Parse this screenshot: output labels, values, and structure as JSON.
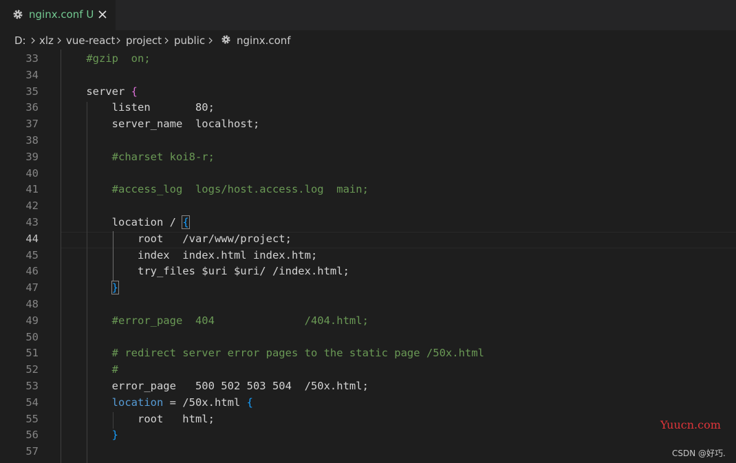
{
  "tab": {
    "title": "nginx.conf",
    "status": "U",
    "icon": "gear-icon",
    "close_icon": "close-icon",
    "color": "#73c991"
  },
  "breadcrumb": {
    "segments": [
      "D:",
      "xlz",
      "vue-react",
      "project",
      "public"
    ],
    "file": "nginx.conf",
    "file_icon": "gear-icon"
  },
  "editor": {
    "active_line": 44,
    "lines": [
      {
        "num": "33",
        "tokens": [
          [
            "    ",
            ""
          ],
          [
            "#gzip  on;",
            "comment"
          ]
        ]
      },
      {
        "num": "34",
        "tokens": []
      },
      {
        "num": "35",
        "tokens": [
          [
            "    server ",
            ""
          ],
          [
            "{",
            "bracket-p"
          ]
        ]
      },
      {
        "num": "36",
        "tokens": [
          [
            "        listen       80",
            ""
          ],
          [
            ";",
            "punc"
          ]
        ]
      },
      {
        "num": "37",
        "tokens": [
          [
            "        server_name  localhost",
            ""
          ],
          [
            ";",
            "punc"
          ]
        ]
      },
      {
        "num": "38",
        "tokens": []
      },
      {
        "num": "39",
        "tokens": [
          [
            "        ",
            ""
          ],
          [
            "#charset koi8-r;",
            "comment"
          ]
        ]
      },
      {
        "num": "40",
        "tokens": []
      },
      {
        "num": "41",
        "tokens": [
          [
            "        ",
            ""
          ],
          [
            "#access_log  logs/host.access.log  main;",
            "comment"
          ]
        ]
      },
      {
        "num": "42",
        "tokens": []
      },
      {
        "num": "43",
        "tokens": [
          [
            "        location / ",
            ""
          ],
          [
            "{",
            "bracket-b-match"
          ]
        ]
      },
      {
        "num": "44",
        "tokens": [
          [
            "            root   /var/www/project",
            ""
          ],
          [
            ";",
            "punc"
          ]
        ]
      },
      {
        "num": "45",
        "tokens": [
          [
            "            index  index.html index.htm",
            ""
          ],
          [
            ";",
            "punc"
          ]
        ]
      },
      {
        "num": "46",
        "tokens": [
          [
            "            try_files $uri $uri/ /index.html",
            ""
          ],
          [
            ";",
            "punc"
          ]
        ]
      },
      {
        "num": "47",
        "tokens": [
          [
            "        ",
            ""
          ],
          [
            "}",
            "bracket-b-match"
          ]
        ]
      },
      {
        "num": "48",
        "tokens": []
      },
      {
        "num": "49",
        "tokens": [
          [
            "        ",
            ""
          ],
          [
            "#error_page  404              /404.html;",
            "comment"
          ]
        ]
      },
      {
        "num": "50",
        "tokens": []
      },
      {
        "num": "51",
        "tokens": [
          [
            "        ",
            ""
          ],
          [
            "# redirect server error pages to the static page /50x.html",
            "comment"
          ]
        ]
      },
      {
        "num": "52",
        "tokens": [
          [
            "        ",
            ""
          ],
          [
            "#",
            "comment"
          ]
        ]
      },
      {
        "num": "53",
        "tokens": [
          [
            "        error_page   500 502 503 504  /50x.html",
            ""
          ],
          [
            ";",
            "punc"
          ]
        ]
      },
      {
        "num": "54",
        "tokens": [
          [
            "        ",
            ""
          ],
          [
            "location",
            "kw"
          ],
          [
            " = /50x.html ",
            ""
          ],
          [
            "{",
            "bracket-b"
          ]
        ]
      },
      {
        "num": "55",
        "tokens": [
          [
            "            root   html",
            ""
          ],
          [
            ";",
            "punc"
          ]
        ]
      },
      {
        "num": "56",
        "tokens": [
          [
            "        ",
            ""
          ],
          [
            "}",
            "bracket-b"
          ]
        ]
      },
      {
        "num": "57",
        "tokens": []
      }
    ]
  },
  "watermark": {
    "site": "Yuucn.com",
    "author": "CSDN @好巧."
  }
}
